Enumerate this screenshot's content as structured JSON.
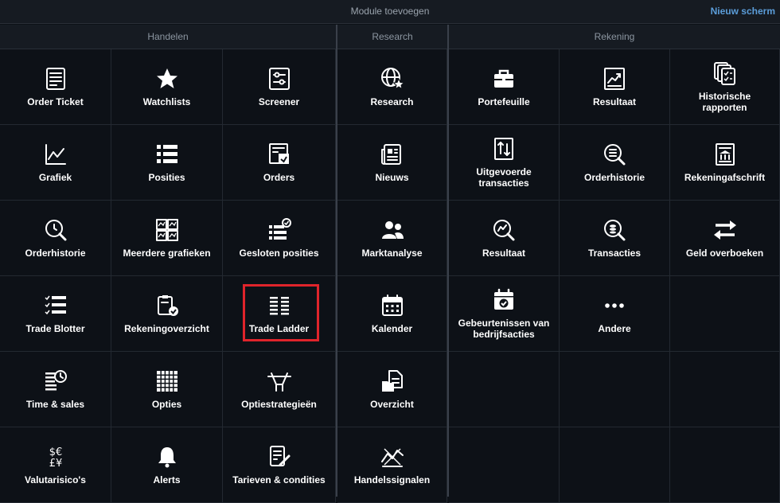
{
  "header": {
    "title": "Module toevoegen",
    "new_screen": "Nieuw scherm"
  },
  "sections": {
    "trading": {
      "title": "Handelen",
      "tiles": [
        {
          "label": "Order Ticket",
          "icon": "order-ticket-icon"
        },
        {
          "label": "Watchlists",
          "icon": "star-icon"
        },
        {
          "label": "Screener",
          "icon": "screener-icon"
        },
        {
          "label": "Grafiek",
          "icon": "line-chart-icon"
        },
        {
          "label": "Posities",
          "icon": "list-icon"
        },
        {
          "label": "Orders",
          "icon": "orders-icon"
        },
        {
          "label": "Orderhistorie",
          "icon": "order-history-icon"
        },
        {
          "label": "Meerdere grafieken",
          "icon": "multi-chart-icon"
        },
        {
          "label": "Gesloten posities",
          "icon": "closed-positions-icon"
        },
        {
          "label": "Trade Blotter",
          "icon": "trade-blotter-icon"
        },
        {
          "label": "Rekeningoverzicht",
          "icon": "account-overview-icon"
        },
        {
          "label": "Trade Ladder",
          "icon": "trade-ladder-icon"
        },
        {
          "label": "Time & sales",
          "icon": "time-sales-icon"
        },
        {
          "label": "Opties",
          "icon": "options-grid-icon"
        },
        {
          "label": "Optiestrategieën",
          "icon": "option-strategy-icon"
        },
        {
          "label": "Valutarisico's",
          "icon": "currency-icon"
        },
        {
          "label": "Alerts",
          "icon": "bell-icon"
        },
        {
          "label": "Tarieven & condities",
          "icon": "terms-icon"
        }
      ]
    },
    "research": {
      "title": "Research",
      "tiles": [
        {
          "label": "Research",
          "icon": "globe-star-icon"
        },
        {
          "label": "Nieuws",
          "icon": "newspaper-icon"
        },
        {
          "label": "Marktanalyse",
          "icon": "people-icon"
        },
        {
          "label": "Kalender",
          "icon": "calendar-icon"
        },
        {
          "label": "Overzicht",
          "icon": "folder-doc-icon"
        },
        {
          "label": "Handelssignalen",
          "icon": "signals-icon"
        }
      ]
    },
    "account": {
      "title": "Rekening",
      "tiles": [
        {
          "label": "Portefeuille",
          "icon": "briefcase-icon"
        },
        {
          "label": "Resultaat",
          "icon": "result-chart-icon"
        },
        {
          "label": "Historische rapporten",
          "icon": "reports-icon"
        },
        {
          "label": "Uitgevoerde transacties",
          "icon": "executed-trades-icon"
        },
        {
          "label": "Orderhistorie",
          "icon": "order-history-search-icon"
        },
        {
          "label": "Rekeningafschrift",
          "icon": "statement-icon"
        },
        {
          "label": "Resultaat",
          "icon": "result-search-icon"
        },
        {
          "label": "Transacties",
          "icon": "transactions-search-icon"
        },
        {
          "label": "Geld overboeken",
          "icon": "transfer-arrows-icon"
        },
        {
          "label": "Gebeurtenissen van bedrijfsacties",
          "icon": "corporate-events-icon"
        },
        {
          "label": "Andere",
          "icon": "more-dots-icon"
        }
      ]
    }
  },
  "highlight_color": "#e0242b",
  "link_color": "#5b9dd9"
}
